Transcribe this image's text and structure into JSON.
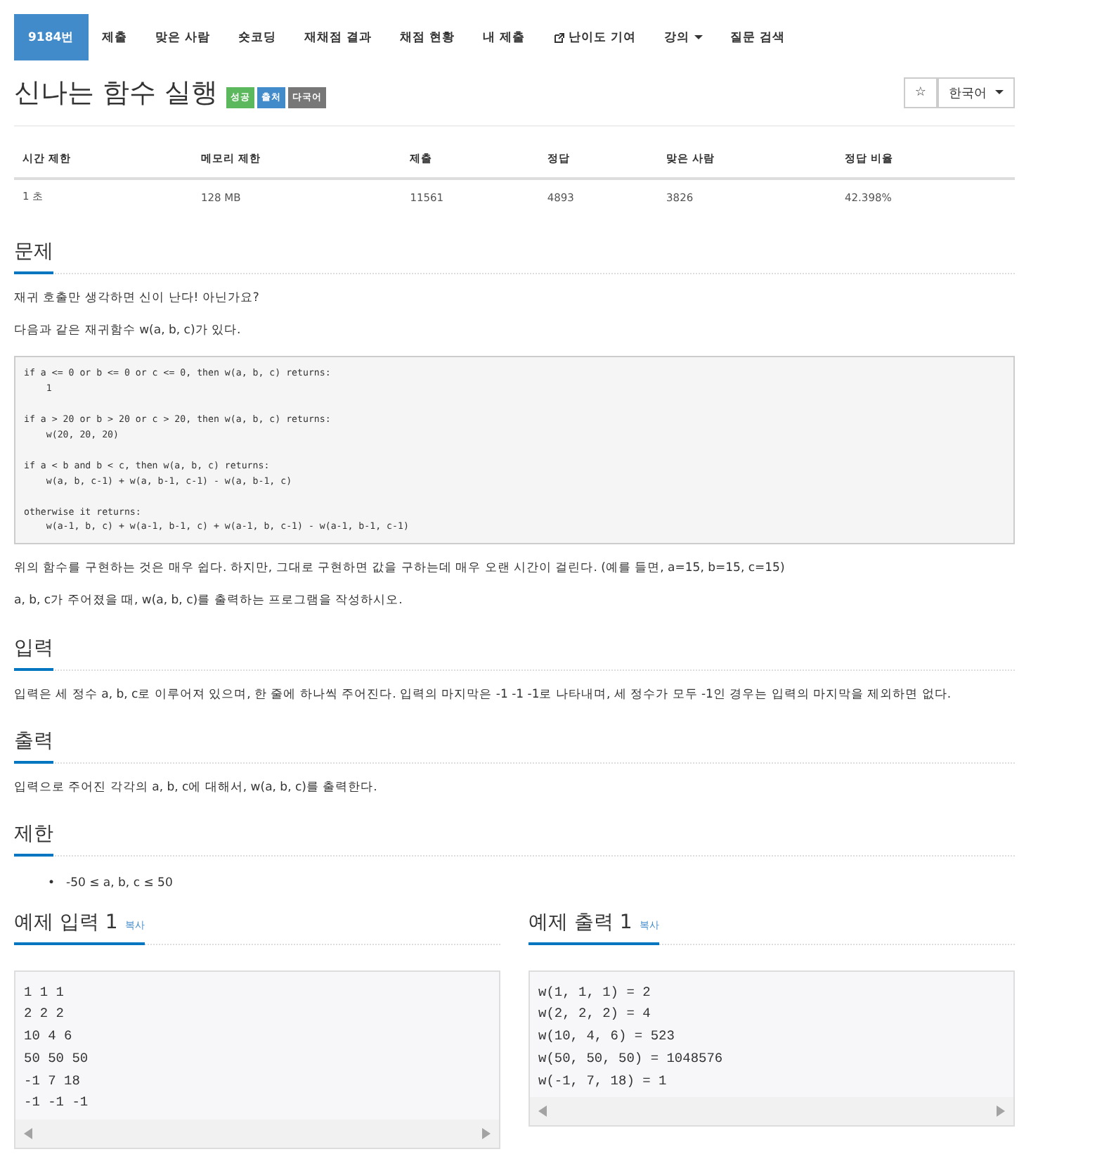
{
  "nav": [
    {
      "label": "9184번",
      "selected": true,
      "kind": "plain"
    },
    {
      "label": "제출",
      "selected": false,
      "kind": "plain"
    },
    {
      "label": "맞은 사람",
      "selected": false,
      "kind": "plain"
    },
    {
      "label": "숏코딩",
      "selected": false,
      "kind": "plain"
    },
    {
      "label": "재채점 결과",
      "selected": false,
      "kind": "plain"
    },
    {
      "label": "채점 현황",
      "selected": false,
      "kind": "plain"
    },
    {
      "label": "내 제출",
      "selected": false,
      "kind": "plain"
    },
    {
      "label": "난이도 기여",
      "selected": false,
      "kind": "external"
    },
    {
      "label": "강의",
      "selected": false,
      "kind": "dropdown"
    },
    {
      "label": "질문 검색",
      "selected": false,
      "kind": "plain"
    }
  ],
  "title": "신나는 함수 실행",
  "labels": [
    {
      "text": "성공",
      "color": "#5cb85c"
    },
    {
      "text": "출처",
      "color": "#428bca"
    },
    {
      "text": "다국어",
      "color": "#777777"
    }
  ],
  "star_button": "☆",
  "language": "한국어",
  "stats": {
    "columns": [
      "시간 제한",
      "메모리 제한",
      "제출",
      "정답",
      "맞은 사람",
      "정답 비율"
    ],
    "row": [
      "1 초",
      "128 MB",
      "11561",
      "4893",
      "3826",
      "42.398%"
    ]
  },
  "problem": {
    "heading": "문제",
    "paragraphs_before": [
      "재귀 호출만 생각하면 신이 난다! 아닌가요?",
      "다음과 같은 재귀함수 w(a, b, c)가 있다."
    ],
    "code": "if a <= 0 or b <= 0 or c <= 0, then w(a, b, c) returns:\n    1\n\nif a > 20 or b > 20 or c > 20, then w(a, b, c) returns:\n    w(20, 20, 20)\n\nif a < b and b < c, then w(a, b, c) returns:\n    w(a, b, c-1) + w(a, b-1, c-1) - w(a, b-1, c)\n\notherwise it returns:\n    w(a-1, b, c) + w(a-1, b-1, c) + w(a-1, b, c-1) - w(a-1, b-1, c-1)",
    "paragraphs_after": [
      "위의 함수를 구현하는 것은 매우 쉽다. 하지만, 그대로 구현하면 값을 구하는데 매우 오랜 시간이 걸린다. (예를 들면, a=15, b=15, c=15)",
      "a, b, c가 주어졌을 때, w(a, b, c)를 출력하는 프로그램을 작성하시오."
    ]
  },
  "input": {
    "heading": "입력",
    "text": "입력은 세 정수 a, b, c로 이루어져 있으며, 한 줄에 하나씩 주어진다. 입력의 마지막은 -1 -1 -1로 나타내며, 세 정수가 모두 -1인 경우는 입력의 마지막을 제외하면 없다."
  },
  "output": {
    "heading": "출력",
    "text": "입력으로 주어진 각각의 a, b, c에 대해서, w(a, b, c)를 출력한다."
  },
  "limits": {
    "heading": "제한",
    "items": [
      {
        "bullet": "•",
        "text": "-50 ≤ a, b, c ≤ 50"
      }
    ]
  },
  "samples": [
    {
      "heading": "예제 입력 1",
      "copy": "복사",
      "content": "1 1 1\n2 2 2\n10 4 6\n50 50 50\n-1 7 18\n-1 -1 -1"
    },
    {
      "heading": "예제 출력 1",
      "copy": "복사",
      "content": "w(1, 1, 1) = 2\nw(2, 2, 2) = 4\nw(10, 4, 6) = 523\nw(50, 50, 50) = 1048576\nw(-1, 7, 18) = 1"
    }
  ]
}
